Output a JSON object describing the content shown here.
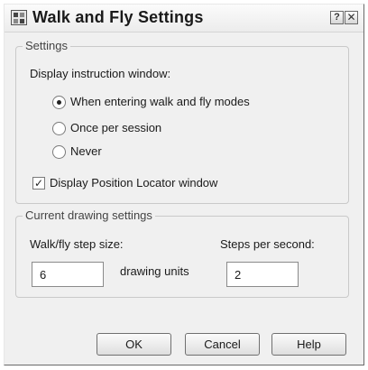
{
  "window": {
    "title": "Walk and Fly Settings",
    "help_glyph": "?",
    "close_glyph": "✕"
  },
  "settings_group": {
    "legend": "Settings",
    "display_instruction_label": "Display instruction window:",
    "options": [
      {
        "label": "When entering walk and fly modes",
        "selected": true
      },
      {
        "label": "Once per session",
        "selected": false
      },
      {
        "label": "Never",
        "selected": false
      }
    ],
    "position_locator": {
      "label": "Display Position Locator window",
      "checked": true,
      "check_glyph": "✓"
    }
  },
  "drawing_group": {
    "legend": "Current drawing settings",
    "step_size_label": "Walk/fly step size:",
    "step_size_value": "6",
    "units_label": "drawing units",
    "steps_per_second_label": "Steps per second:",
    "steps_per_second_value": "2"
  },
  "buttons": {
    "ok": "OK",
    "cancel": "Cancel",
    "help": "Help"
  }
}
